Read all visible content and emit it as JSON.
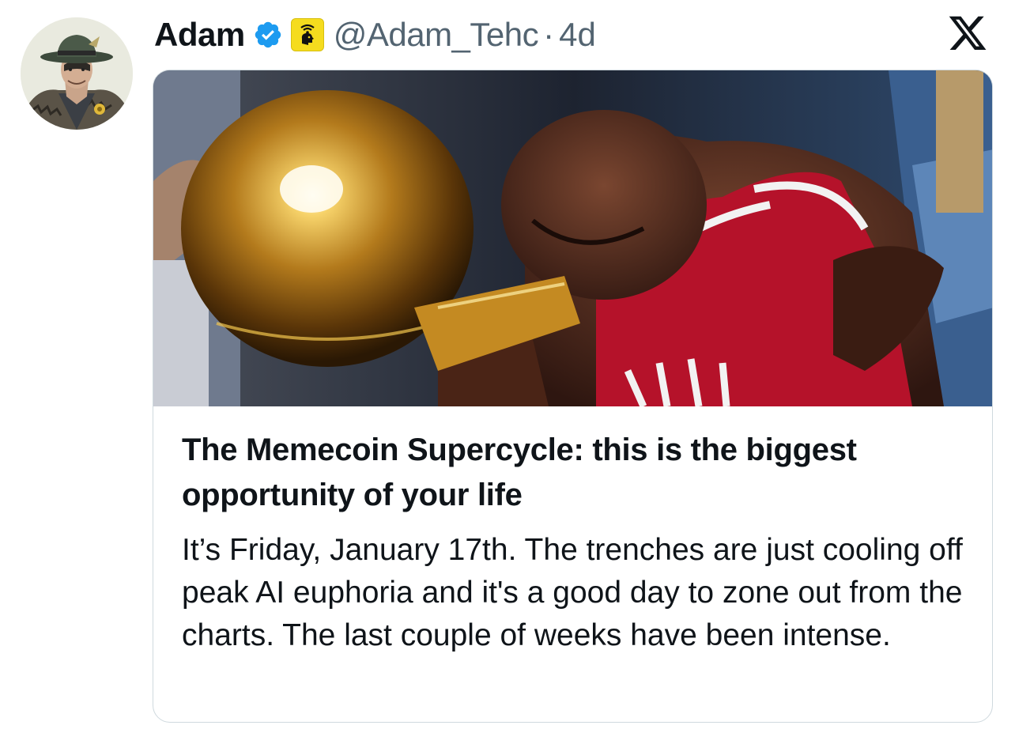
{
  "author": {
    "display_name": "Adam",
    "handle": "@Adam_Tehc",
    "separator": "·",
    "time_ago": "4d",
    "verified_icon": "verified-badge-icon",
    "affiliate_icon": "affiliate-badge-icon",
    "avatar_icon": "avatar-cartoon-man-hat"
  },
  "platform": {
    "logo_icon": "x-logo-icon"
  },
  "card": {
    "image_icon": "basketball-player-trophy-photo",
    "title": "The Memecoin Supercycle: this is the biggest opportunity of your life",
    "description": "It’s Friday, January 17th. The trenches are just cooling off peak AI euphoria and it's a good day to zone out from the charts. The last couple of weeks have been intense."
  },
  "colors": {
    "verified_blue": "#1d9bf0",
    "affiliate_yellow": "#f5dc1e",
    "muted_text": "#536471",
    "card_border": "#cfd9de"
  }
}
